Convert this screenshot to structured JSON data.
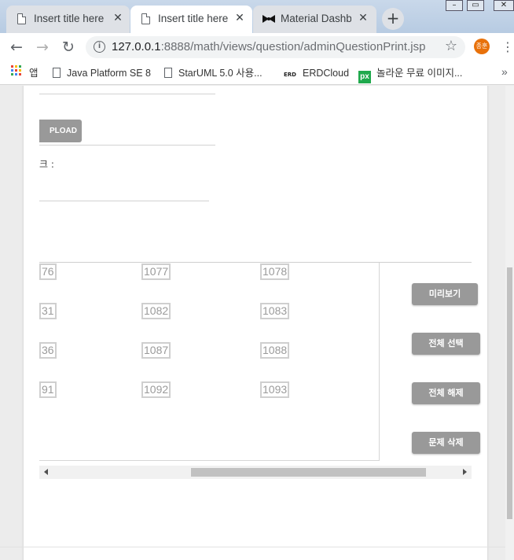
{
  "browser": {
    "tabs": [
      {
        "title": "Insert title here",
        "close": "✕"
      },
      {
        "title": "Insert title here",
        "close": "✕"
      },
      {
        "title": "Material Dashboard",
        "close": "✕"
      }
    ],
    "new_tab": "+",
    "window_controls": [
      "–",
      "▭",
      "✕"
    ],
    "url_host": "127.0.0.1",
    "url_rest": ":8888/math/views/question/adminQuestionPrint.jsp",
    "profile_initials": "종훈",
    "bookmarks": [
      {
        "label": "앱",
        "icon": "apps-grid-icon"
      },
      {
        "label": "Java Platform SE 8",
        "icon": "page-icon"
      },
      {
        "label": "StarUML 5.0 사용...",
        "icon": "page-icon"
      },
      {
        "label": "ERDCloud",
        "icon": "erd-icon"
      },
      {
        "label": "놀라운 무료 이미지...",
        "icon": "px-icon"
      }
    ],
    "bookmarks_more": "»",
    "accent_profile": "#e8710a"
  },
  "page": {
    "upload_label": "PLOAD",
    "partial_label": "크 :",
    "question_rows": [
      [
        "76",
        "1077",
        "1078"
      ],
      [
        "31",
        "1082",
        "1083"
      ],
      [
        "36",
        "1087",
        "1088"
      ],
      [
        "91",
        "1092",
        "1093"
      ]
    ],
    "actions": {
      "preview": "미리보기",
      "select_all": "전체 선택",
      "deselect_all": "전체 해제",
      "delete": "문제 삭제"
    },
    "button_color": "#999999"
  }
}
